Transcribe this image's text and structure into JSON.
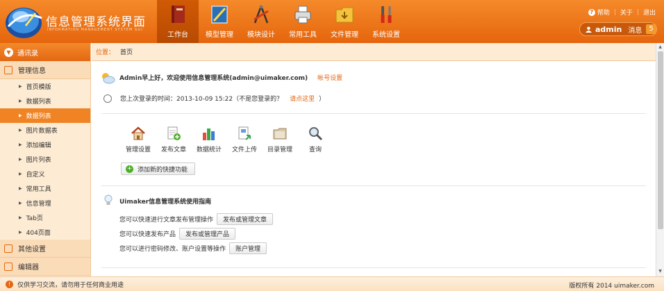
{
  "header": {
    "title": "信息管理系统界面",
    "subtitle": "INFORMATION MANAGEMENT SYSTEM GUI",
    "nav": [
      {
        "label": "工作台",
        "icon": "book-icon",
        "active": true
      },
      {
        "label": "模型管理",
        "icon": "ruler-icon",
        "active": false
      },
      {
        "label": "模块设计",
        "icon": "compass-icon",
        "active": false
      },
      {
        "label": "常用工具",
        "icon": "printer-icon",
        "active": false
      },
      {
        "label": "文件管理",
        "icon": "folder-icon",
        "active": false
      },
      {
        "label": "系统设置",
        "icon": "tools-icon",
        "active": false
      }
    ],
    "links": {
      "help": "帮助",
      "about": "关于",
      "logout": "退出"
    },
    "user": {
      "name": "admin",
      "messages_label": "消息",
      "messages_count": "5"
    }
  },
  "sidebar": {
    "header": "通讯录",
    "sections": [
      {
        "label": "管理信息"
      },
      {
        "label": "其他设置"
      },
      {
        "label": "编辑器"
      }
    ],
    "items": [
      "首页模版",
      "数据列表",
      "数据列表",
      "图片数据表",
      "添加编辑",
      "图片列表",
      "自定义",
      "常用工具",
      "信息管理",
      "Tab页",
      "404页面"
    ],
    "active_index": 2
  },
  "breadcrumb": {
    "label": "位置：",
    "current": "首页"
  },
  "main": {
    "welcome": "Admin早上好，欢迎使用信息管理系统(admin@uimaker.com)",
    "account_link": "帐号设置",
    "last_login_text": "您上次登录的时间：2013-10-09 15:22（不是您登录的？",
    "last_login_link": "请点这里",
    "last_login_close": "）",
    "quick": [
      {
        "label": "管理设置",
        "icon": "home-icon"
      },
      {
        "label": "发布文章",
        "icon": "document-add-icon"
      },
      {
        "label": "数据统计",
        "icon": "bar-chart-icon"
      },
      {
        "label": "文件上传",
        "icon": "file-upload-icon"
      },
      {
        "label": "目录管理",
        "icon": "folder-icon"
      },
      {
        "label": "查询",
        "icon": "magnifier-icon"
      }
    ],
    "add_shortcut": "添加新的快捷功能",
    "guide_title": "Uimaker信息管理系统使用指南",
    "guide_rows": [
      {
        "text": "您可以快速进行文章发布管理操作",
        "button": "发布或管理文章"
      },
      {
        "text": "您可以快速发布产品",
        "button": "发布或管理产品"
      },
      {
        "text": "您可以进行密码修改、账户设置等操作",
        "button": "账户管理"
      }
    ]
  },
  "footer": {
    "notice": "仅供学习交流，请勿用于任何商业用途",
    "copyright": "版权所有 2014 uimaker.com"
  }
}
